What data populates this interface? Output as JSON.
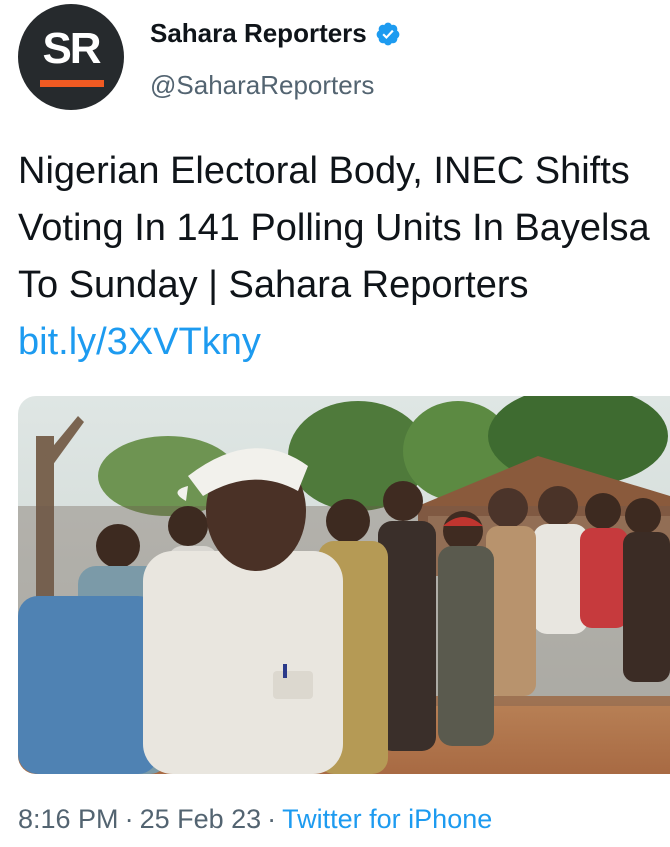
{
  "author": {
    "display_name": "Sahara Reporters",
    "handle": "@SaharaReporters",
    "avatar_text": "SR",
    "verified": true
  },
  "tweet": {
    "text": "Nigerian Electoral Body, INEC Shifts Voting In 141 Polling Units In Bayelsa To Sunday | Sahara Reporters",
    "link": "bit.ly/3XVTkny"
  },
  "meta": {
    "time": "8:16 PM",
    "date": "25 Feb 23",
    "separator": "·",
    "source": "Twitter for iPhone"
  },
  "colors": {
    "link": "#1d9bf0",
    "secondary_text": "#536471",
    "logo_accent": "#f05a22",
    "avatar_bg": "#262a2d"
  },
  "icons": {
    "verified": "verified-badge-icon"
  }
}
